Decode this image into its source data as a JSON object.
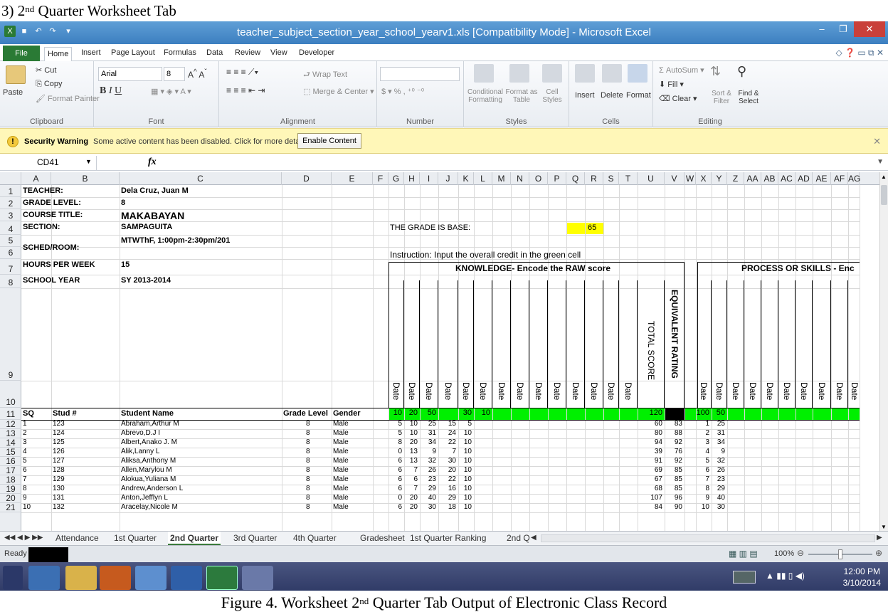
{
  "caption_top": {
    "prefix": "3) 2",
    "sup": "nd",
    "suffix": " Quarter Worksheet Tab"
  },
  "caption_bottom": {
    "prefix": "Figure 4. Worksheet 2",
    "sup": "nd",
    "suffix": " Quarter Tab Output of Electronic Class Record"
  },
  "window": {
    "title": "teacher_subject_section_year_school_yearv1.xls  [Compatibility Mode] - Microsoft Excel"
  },
  "ribbon_tabs": [
    "File",
    "Home",
    "Insert",
    "Page Layout",
    "Formulas",
    "Data",
    "Review",
    "View",
    "Developer"
  ],
  "clipboard": {
    "cut": "Cut",
    "copy": "Copy",
    "paste": "Paste",
    "format_painter": "Format Painter",
    "label": "Clipboard"
  },
  "font": {
    "name": "Arial",
    "size": "8",
    "label": "Font"
  },
  "alignment": {
    "wrap_text": "Wrap Text",
    "merge": "Merge & Center",
    "label": "Alignment"
  },
  "number": {
    "label": "Number",
    "percent": "%"
  },
  "styles": {
    "conditional": "Conditional Formatting",
    "format_table": "Format as Table",
    "cell_styles": "Cell Styles",
    "label": "Styles"
  },
  "cells": {
    "insert": "Insert",
    "delete": "Delete",
    "format": "Format",
    "label": "Cells"
  },
  "editing": {
    "autosum": "AutoSum",
    "fill": "Fill",
    "clear": "Clear",
    "sort": "Sort & Filter",
    "find": "Find & Select",
    "label": "Editing"
  },
  "security": {
    "title": "Security Warning",
    "message": "Some active content has been disabled. Click for more details.",
    "button": "Enable Content"
  },
  "formula_bar": {
    "cell_ref": "CD41",
    "fx": "fx"
  },
  "columns": [
    "A",
    "B",
    "C",
    "D",
    "E",
    "F",
    "G",
    "H",
    "I",
    "J",
    "K",
    "L",
    "M",
    "N",
    "O",
    "P",
    "Q",
    "R",
    "S",
    "T",
    "U",
    "V",
    "W",
    "X",
    "Y",
    "Z",
    "AA",
    "AB",
    "AC",
    "AD",
    "AE",
    "AF",
    "AG"
  ],
  "info": {
    "teacher_label": "TEACHER:",
    "teacher": "Dela Cruz, Juan M",
    "grade_label": "GRADE LEVEL:",
    "grade": "8",
    "course_label": "COURSE TITLE:",
    "course": "MAKABAYAN",
    "section_label": "SECTION:",
    "section": "SAMPAGUITA",
    "sched_label": "SCHED/ROOM:",
    "sched": "MTWThF, 1:00pm-2:30pm/201",
    "hours_label": "HOURS PER WEEK",
    "hours": "15",
    "year_label": "SCHOOL YEAR",
    "year": "SY 2013-2014"
  },
  "grade_base": {
    "label": "THE GRADE IS BASE:",
    "value": "65"
  },
  "instruction": "Instruction: Input the overall credit in the green cell",
  "knowledge_header": "KNOWLEDGE- Encode the RAW score",
  "process_header": "PROCESS OR SKILLS  - Enc",
  "vertical_labels": {
    "date": "Date",
    "total": "TOTAL SCORE",
    "equiv": "EQUIVALENT RATING"
  },
  "header_row": {
    "sq": "SQ",
    "stud": "Stud #",
    "name": "Student Name",
    "grade_level": "Grade Level",
    "gender": "Gender"
  },
  "credit_row": {
    "k": [
      "10",
      "20",
      "50",
      "30",
      "10"
    ],
    "total": "120",
    "p": [
      "100",
      "50"
    ]
  },
  "students": [
    {
      "sq": "1",
      "stud": "123",
      "name": "Abraham,Arthur M",
      "gl": "8",
      "gender": "Male",
      "s": [
        "5",
        "10",
        "25",
        "15",
        "5"
      ],
      "total": "60",
      "eq": "83",
      "p1": "1",
      "p2": "25"
    },
    {
      "sq": "2",
      "stud": "124",
      "name": "Abrevo,D.J I",
      "gl": "8",
      "gender": "Male",
      "s": [
        "5",
        "10",
        "31",
        "24",
        "10"
      ],
      "total": "80",
      "eq": "88",
      "p1": "2",
      "p2": "31"
    },
    {
      "sq": "3",
      "stud": "125",
      "name": "Albert,Anako J. M",
      "gl": "8",
      "gender": "Male",
      "s": [
        "8",
        "20",
        "34",
        "22",
        "10"
      ],
      "total": "94",
      "eq": "92",
      "p1": "3",
      "p2": "34"
    },
    {
      "sq": "4",
      "stud": "126",
      "name": "Alik,Lanny L",
      "gl": "8",
      "gender": "Male",
      "s": [
        "0",
        "13",
        "9",
        "7",
        "10"
      ],
      "total": "39",
      "eq": "76",
      "p1": "4",
      "p2": "9"
    },
    {
      "sq": "5",
      "stud": "127",
      "name": "Aliksa,Anthony M",
      "gl": "8",
      "gender": "Male",
      "s": [
        "6",
        "13",
        "32",
        "30",
        "10"
      ],
      "total": "91",
      "eq": "92",
      "p1": "5",
      "p2": "32"
    },
    {
      "sq": "6",
      "stud": "128",
      "name": "Allen,Marylou M",
      "gl": "8",
      "gender": "Male",
      "s": [
        "6",
        "7",
        "26",
        "20",
        "10"
      ],
      "total": "69",
      "eq": "85",
      "p1": "6",
      "p2": "26"
    },
    {
      "sq": "7",
      "stud": "129",
      "name": "Alokua,Yuliana  M",
      "gl": "8",
      "gender": "Male",
      "s": [
        "6",
        "6",
        "23",
        "22",
        "10"
      ],
      "total": "67",
      "eq": "85",
      "p1": "7",
      "p2": "23"
    },
    {
      "sq": "8",
      "stud": "130",
      "name": "Andrew,Anderson L",
      "gl": "8",
      "gender": "Male",
      "s": [
        "6",
        "7",
        "29",
        "16",
        "10"
      ],
      "total": "68",
      "eq": "85",
      "p1": "8",
      "p2": "29"
    },
    {
      "sq": "9",
      "stud": "131",
      "name": "Anton,Jefflyn L",
      "gl": "8",
      "gender": "Male",
      "s": [
        "0",
        "20",
        "40",
        "29",
        "10"
      ],
      "total": "107",
      "eq": "96",
      "p1": "9",
      "p2": "40"
    },
    {
      "sq": "10",
      "stud": "132",
      "name": "Aracelay,Nicole M",
      "gl": "8",
      "gender": "Male",
      "s": [
        "6",
        "20",
        "30",
        "18",
        "10"
      ],
      "total": "84",
      "eq": "90",
      "p1": "10",
      "p2": "30"
    }
  ],
  "sheet_tabs": [
    "Attendance",
    "1st Quarter",
    "2nd Quarter",
    "3rd Quarter",
    "4th Quarter",
    "Gradesheet",
    "1st Quarter Ranking",
    "2nd Q"
  ],
  "status": {
    "ready": "Ready",
    "zoom": "100%"
  },
  "clock": {
    "time": "12:00 PM",
    "date": "3/10/2014"
  },
  "colors": {
    "green": "#00f000",
    "yellow": "#ffff00",
    "excel_green": "#2a7a35",
    "title_blue": "#4a8ccc"
  }
}
